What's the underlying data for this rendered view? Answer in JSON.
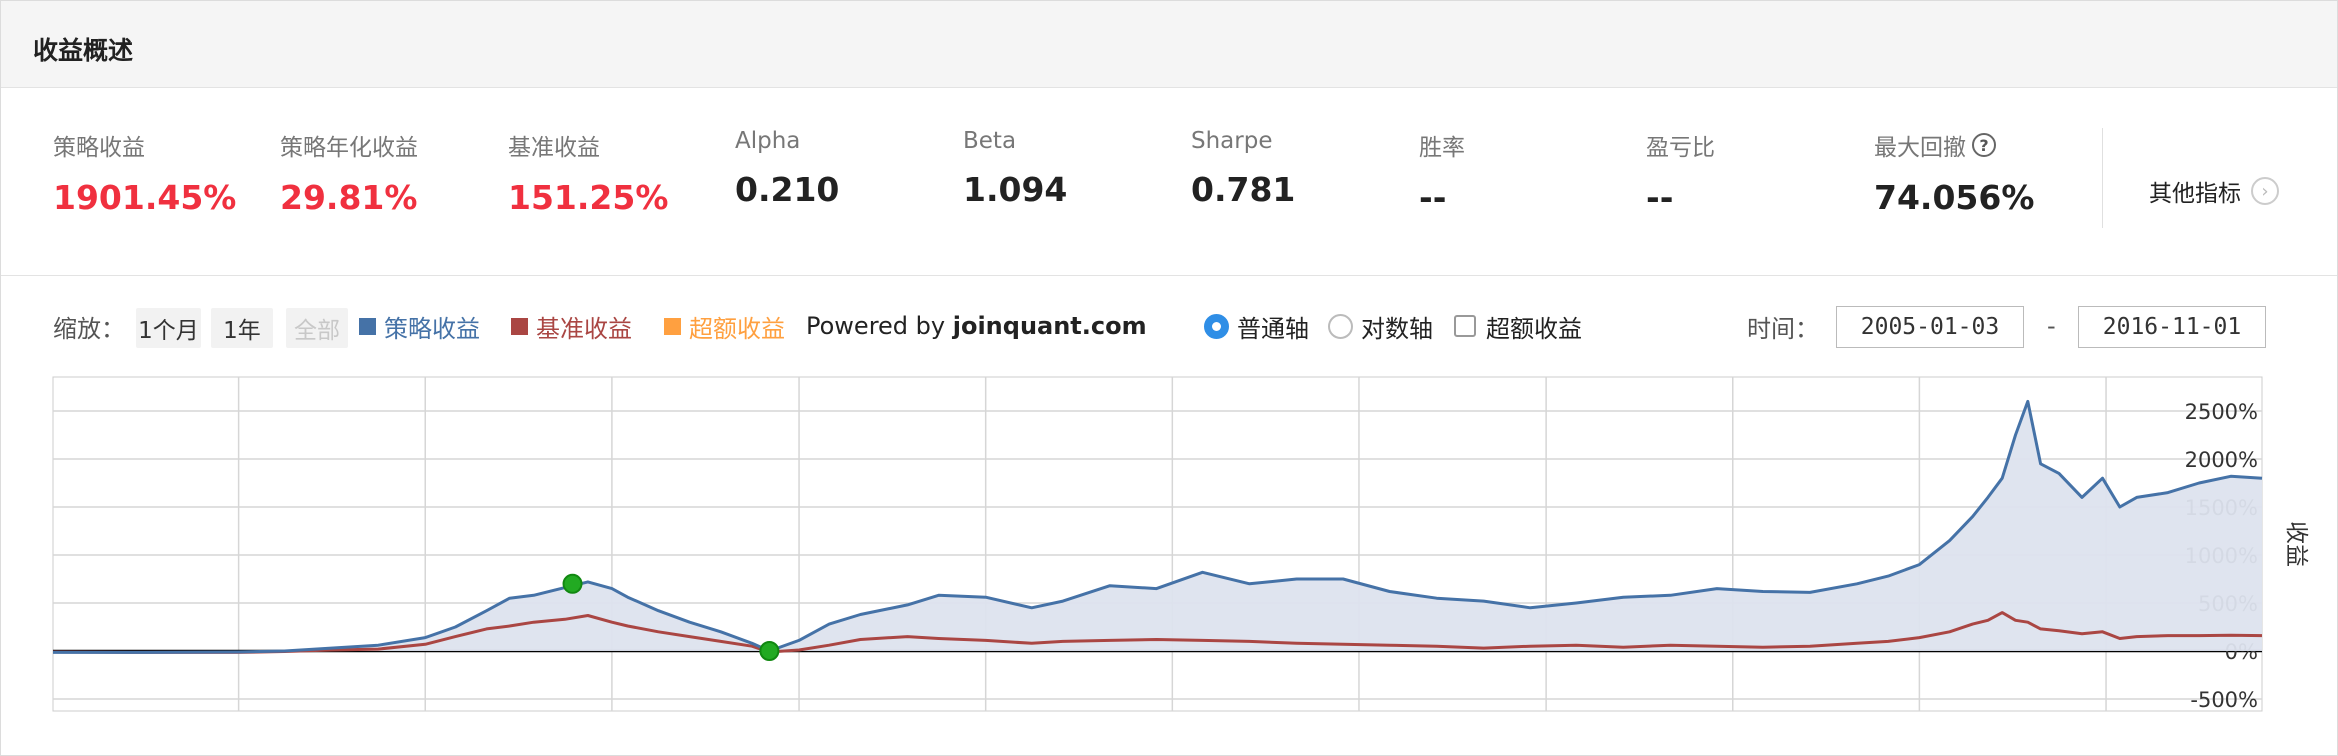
{
  "header": {
    "title": "收益概述"
  },
  "metrics": [
    {
      "label": "策略收益",
      "value": "1901.45%",
      "color": "red"
    },
    {
      "label": "策略年化收益",
      "value": "29.81%",
      "color": "red"
    },
    {
      "label": "基准收益",
      "value": "151.25%",
      "color": "red"
    },
    {
      "label": "Alpha",
      "value": "0.210",
      "color": "black"
    },
    {
      "label": "Beta",
      "value": "1.094",
      "color": "black"
    },
    {
      "label": "Sharpe",
      "value": "0.781",
      "color": "black"
    },
    {
      "label": "胜率",
      "value": "--",
      "color": "black"
    },
    {
      "label": "盈亏比",
      "value": "--",
      "color": "black"
    },
    {
      "label": "最大回撤",
      "value": "74.056%",
      "color": "black",
      "help_icon": "question-icon",
      "help_glyph": "?"
    }
  ],
  "other_metrics": {
    "label": "其他指标",
    "icon": "chevron-right-icon",
    "glyph": "›"
  },
  "toolbar": {
    "zoom_label": "缩放：",
    "zoom_buttons": [
      "1个月",
      "1年",
      "全部"
    ],
    "legend": [
      {
        "label": "策略收益",
        "color": "#4572a7"
      },
      {
        "label": "基准收益",
        "color": "#aa4643"
      },
      {
        "label": "超额收益",
        "color": "#ffa040"
      }
    ],
    "powered_prefix": "Powered by ",
    "powered_site": "joinquant.com",
    "axis_options": [
      {
        "label": "普通轴",
        "checked": true
      },
      {
        "label": "对数轴",
        "checked": false
      }
    ],
    "excess_checkbox": {
      "label": "超额收益",
      "checked": false
    },
    "time_label": "时间：",
    "start_date": "2005-01-03",
    "date_separator": "-",
    "end_date": "2016-11-01"
  },
  "chart_data": {
    "type": "area",
    "x_range": [
      "2005-01-03",
      "2016-11-01"
    ],
    "ylabel": "收益",
    "ylim": [
      -500,
      2500
    ],
    "y_ticks": [
      "2500%",
      "2000%",
      "1500%",
      "1000%",
      "500%",
      "0%",
      "-500%"
    ],
    "grid": true,
    "series": [
      {
        "name": "策略收益",
        "color": "#4572a7",
        "fill": "#dde3ee",
        "x": [
          "2005-01-03",
          "2005-07-01",
          "2006-01-01",
          "2006-04-01",
          "2006-07-01",
          "2006-10-01",
          "2007-01-01",
          "2007-03-01",
          "2007-05-01",
          "2007-06-15",
          "2007-08-01",
          "2007-10-01",
          "2007-11-15",
          "2008-01-01",
          "2008-02-01",
          "2008-04-01",
          "2008-06-01",
          "2008-08-01",
          "2008-10-01",
          "2008-11-04",
          "2009-01-01",
          "2009-03-01",
          "2009-05-01",
          "2009-08-01",
          "2009-10-01",
          "2010-01-01",
          "2010-04-01",
          "2010-06-01",
          "2010-09-01",
          "2010-12-01",
          "2011-03-01",
          "2011-06-01",
          "2011-09-01",
          "2011-12-01",
          "2012-03-01",
          "2012-06-01",
          "2012-09-01",
          "2012-12-01",
          "2013-03-01",
          "2013-06-01",
          "2013-09-01",
          "2013-12-01",
          "2014-03-01",
          "2014-06-01",
          "2014-09-01",
          "2014-11-01",
          "2015-01-01",
          "2015-03-01",
          "2015-04-15",
          "2015-05-15",
          "2015-06-12",
          "2015-07-08",
          "2015-08-01",
          "2015-08-26",
          "2015-10-01",
          "2015-11-15",
          "2015-12-25",
          "2016-01-28",
          "2016-03-01",
          "2016-05-01",
          "2016-07-01",
          "2016-09-01",
          "2016-11-01"
        ],
        "y": [
          -15,
          -15,
          -10,
          0,
          30,
          60,
          140,
          250,
          420,
          550,
          580,
          660,
          720,
          650,
          560,
          420,
          300,
          200,
          80,
          0,
          110,
          280,
          380,
          480,
          580,
          560,
          450,
          520,
          680,
          650,
          820,
          700,
          750,
          750,
          620,
          550,
          520,
          450,
          500,
          560,
          580,
          650,
          620,
          610,
          700,
          780,
          900,
          1150,
          1400,
          1600,
          1800,
          2250,
          2600,
          1950,
          1850,
          1600,
          1800,
          1500,
          1600,
          1650,
          1750,
          1820,
          1800
        ]
      },
      {
        "name": "基准收益",
        "color": "#aa4643",
        "x": [
          "2005-01-03",
          "2005-07-01",
          "2006-01-01",
          "2006-04-01",
          "2006-07-01",
          "2006-10-01",
          "2007-01-01",
          "2007-03-01",
          "2007-05-01",
          "2007-06-15",
          "2007-08-01",
          "2007-10-01",
          "2007-11-15",
          "2008-01-01",
          "2008-02-01",
          "2008-04-01",
          "2008-06-01",
          "2008-08-01",
          "2008-10-01",
          "2008-11-04",
          "2009-01-01",
          "2009-03-01",
          "2009-05-01",
          "2009-08-01",
          "2009-10-01",
          "2010-01-01",
          "2010-04-01",
          "2010-06-01",
          "2010-09-01",
          "2010-12-01",
          "2011-03-01",
          "2011-06-01",
          "2011-09-01",
          "2011-12-01",
          "2012-03-01",
          "2012-06-01",
          "2012-09-01",
          "2012-12-01",
          "2013-03-01",
          "2013-06-01",
          "2013-09-01",
          "2013-12-01",
          "2014-03-01",
          "2014-06-01",
          "2014-09-01",
          "2014-11-01",
          "2015-01-01",
          "2015-03-01",
          "2015-04-15",
          "2015-05-15",
          "2015-06-12",
          "2015-07-08",
          "2015-08-01",
          "2015-08-26",
          "2015-10-01",
          "2015-11-15",
          "2015-12-25",
          "2016-01-28",
          "2016-03-01",
          "2016-05-01",
          "2016-07-01",
          "2016-09-01",
          "2016-11-01"
        ],
        "y": [
          -10,
          -15,
          -15,
          -5,
          10,
          20,
          70,
          150,
          230,
          260,
          300,
          330,
          370,
          300,
          260,
          200,
          150,
          100,
          50,
          -10,
          10,
          60,
          120,
          150,
          130,
          110,
          80,
          100,
          110,
          120,
          110,
          100,
          80,
          70,
          60,
          50,
          30,
          50,
          60,
          40,
          60,
          50,
          40,
          50,
          80,
          100,
          140,
          200,
          280,
          320,
          400,
          320,
          300,
          230,
          210,
          180,
          200,
          130,
          150,
          160,
          160,
          165,
          160
        ]
      }
    ],
    "markers": [
      {
        "x": "2007-10-16",
        "y": 700,
        "color": "#22aa22"
      },
      {
        "x": "2008-11-04",
        "y": 0,
        "color": "#22aa22"
      }
    ]
  }
}
